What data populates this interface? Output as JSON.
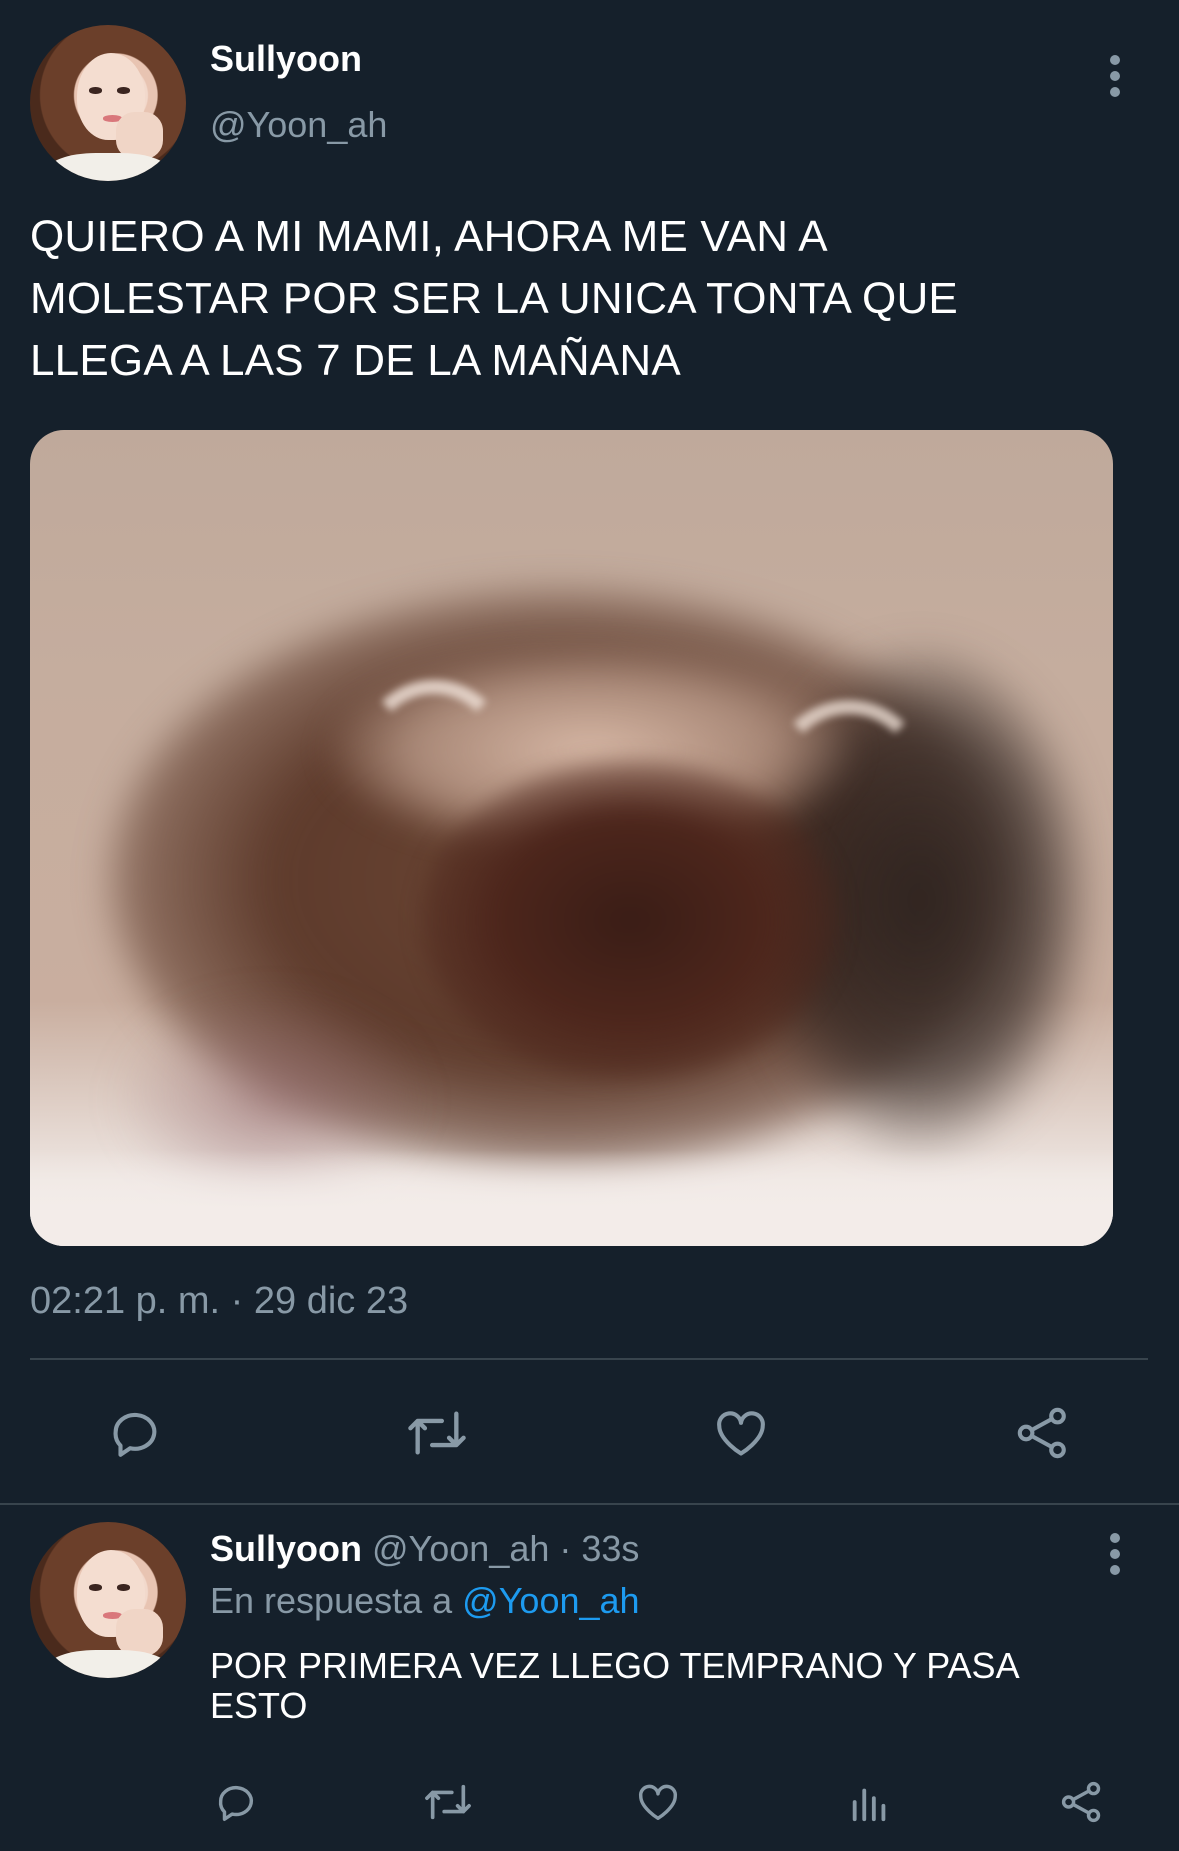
{
  "main_tweet": {
    "display_name": "Sullyoon",
    "handle": "@Yoon_ah",
    "text_lines": [
      "QUIERO A MI MAMI, AHORA ME VAN A",
      "MOLESTAR POR SER LA UNICA TONTA QUE",
      "LLEGA A LAS 7 DE LA MAÑANA"
    ],
    "timestamp": "02:21 p. m. · 29 dic 23",
    "actions": [
      "reply-icon",
      "retweet-icon",
      "like-icon",
      "share-icon"
    ]
  },
  "reply_tweet": {
    "display_name": "Sullyoon",
    "handle_time": "@Yoon_ah · 33s",
    "in_reply_prefix": "En respuesta a",
    "in_reply_handle": "@Yoon_ah",
    "text_lines": [
      "POR PRIMERA VEZ LLEGO TEMPRANO Y PASA",
      "ESTO"
    ],
    "actions": [
      "reply-icon",
      "retweet-icon",
      "like-icon",
      "analytics-icon",
      "share-icon"
    ]
  },
  "colors": {
    "background": "#15202b",
    "muted": "#8899a6",
    "link": "#1d9bf0",
    "divider": "#38444d"
  }
}
